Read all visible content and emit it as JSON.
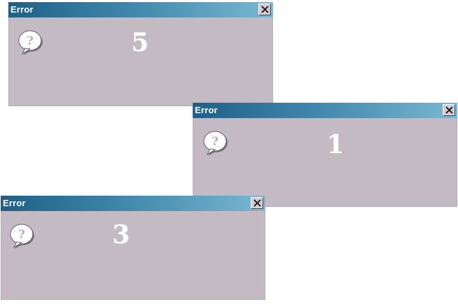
{
  "dialogs": [
    {
      "title": "Error",
      "number": "5",
      "icon": "question-bubble-icon"
    },
    {
      "title": "Error",
      "number": "1",
      "icon": "question-bubble-icon"
    },
    {
      "title": "Error",
      "number": "3",
      "icon": "question-bubble-icon"
    }
  ],
  "colors": {
    "titlebar_start": "#1f5f86",
    "titlebar_end": "#79b8d2",
    "body": "#c4bac4",
    "title_text": "#ffffff"
  }
}
